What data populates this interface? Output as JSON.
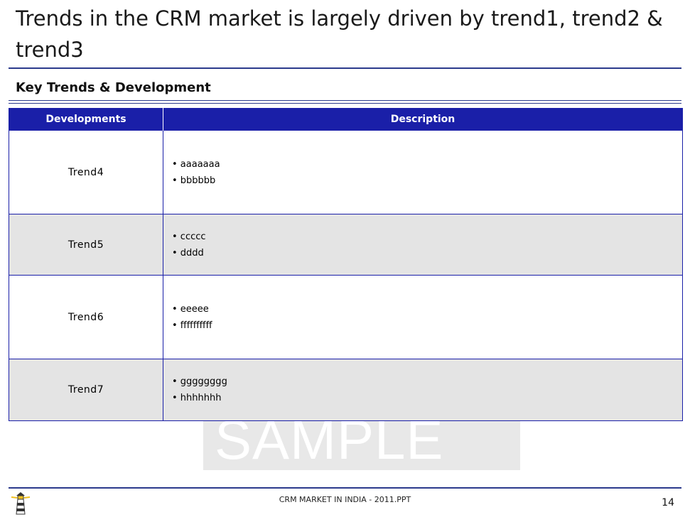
{
  "slide": {
    "title": "Trends in the CRM market is largely driven by trend1, trend2 & trend3",
    "subtitle": "Key Trends & Development",
    "watermark": "SAMPLE"
  },
  "table": {
    "headers": [
      "Developments",
      "Description"
    ],
    "rows": [
      {
        "development": "Trend4",
        "bullets": [
          "• aaaaaaa",
          "• bbbbbb"
        ]
      },
      {
        "development": "Trend5",
        "bullets": [
          "• ccccc",
          "• dddd"
        ]
      },
      {
        "development": "Trend6",
        "bullets": [
          "• eeeee",
          "• ffffffffff"
        ]
      },
      {
        "development": "Trend7",
        "bullets": [
          "• gggggggg",
          "• hhhhhhh"
        ]
      }
    ]
  },
  "footer": {
    "text": "CRM MARKET IN INDIA - 2011.PPT",
    "page_number": "14",
    "logo_icon": "lighthouse-icon"
  },
  "colors": {
    "header_bg": "#1a1fa8",
    "rule": "#2b3a8c",
    "alt_row_bg": "#e4e4e4"
  }
}
